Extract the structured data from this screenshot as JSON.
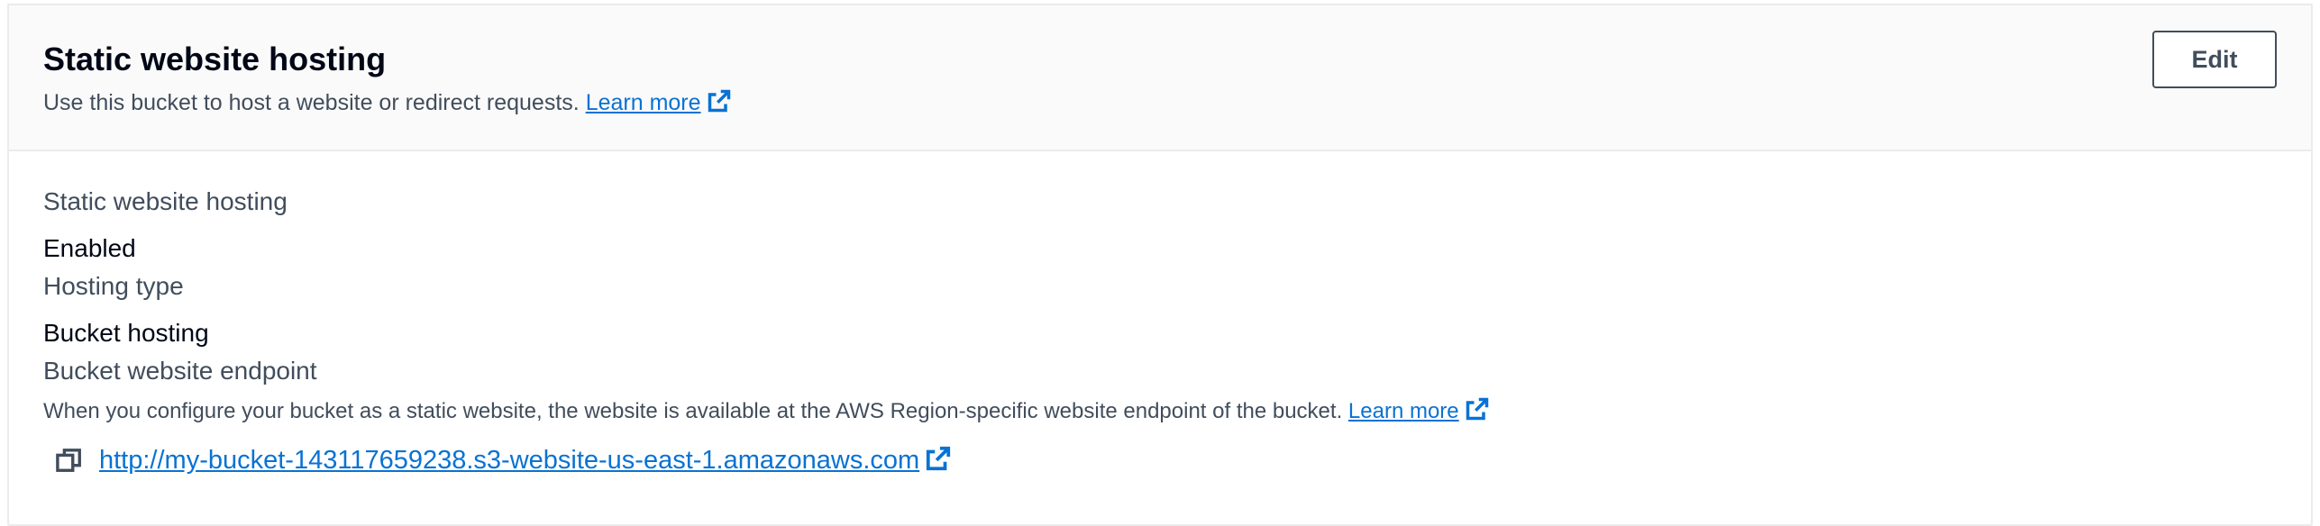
{
  "section": {
    "title": "Static website hosting",
    "description": "Use this bucket to host a website or redirect requests.",
    "learn_more": "Learn more",
    "edit_label": "Edit"
  },
  "fields": {
    "hosting_label": "Static website hosting",
    "hosting_value": "Enabled",
    "type_label": "Hosting type",
    "type_value": "Bucket hosting",
    "endpoint_label": "Bucket website endpoint",
    "endpoint_description": "When you configure your bucket as a static website, the website is available at the AWS Region-specific website endpoint of the bucket.",
    "endpoint_learn_more": "Learn more",
    "endpoint_url": "http://my-bucket-143117659238.s3-website-us-east-1.amazonaws.com"
  },
  "icons": {
    "external_link": "external-link-icon",
    "copy": "copy-icon"
  },
  "colors": {
    "link": "#0972d3",
    "text_primary": "#000716",
    "text_secondary": "#414d5c",
    "header_bg": "#fafafa",
    "border": "#e9ebed"
  }
}
